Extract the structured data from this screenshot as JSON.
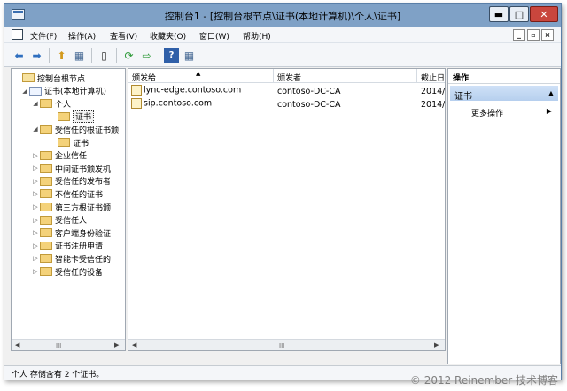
{
  "window": {
    "title": "控制台1 - [控制台根节点\\证书(本地计算机)\\个人\\证书]",
    "controls": {
      "minimize": "▬",
      "maximize": "□",
      "close": "✕"
    }
  },
  "menubar": {
    "items": [
      "文件(F)",
      "操作(A)",
      "查看(V)",
      "收藏夹(O)",
      "窗口(W)",
      "帮助(H)"
    ],
    "mdi_controls": [
      "_",
      "▫",
      "×"
    ]
  },
  "toolbar": {
    "icons": [
      "back-arrow-icon",
      "forward-arrow-icon",
      "up-folder-icon",
      "show-hide-tree-icon",
      "copy-icon",
      "refresh-icon",
      "export-list-icon",
      "help-icon",
      "show-hide-action-pane-icon"
    ],
    "glyphs": [
      "⬅",
      "➡",
      "⬆",
      "▦",
      "▯",
      "⟳",
      "⇨",
      "?",
      "▦"
    ]
  },
  "tree": {
    "items": [
      {
        "label": "控制台根节点",
        "level": 0,
        "expander": "",
        "icon": "root"
      },
      {
        "label": "证书(本地计算机)",
        "level": 1,
        "expander": "◢",
        "icon": "cert"
      },
      {
        "label": "个人",
        "level": 2,
        "expander": "◢",
        "icon": "folder"
      },
      {
        "label": "证书",
        "level": 3,
        "expander": "",
        "icon": "folder",
        "selected": true
      },
      {
        "label": "受信任的根证书颁",
        "level": 2,
        "expander": "◢",
        "icon": "folder"
      },
      {
        "label": "证书",
        "level": 3,
        "expander": "",
        "icon": "folder"
      },
      {
        "label": "企业信任",
        "level": 2,
        "expander": "▷",
        "icon": "folder"
      },
      {
        "label": "中间证书颁发机",
        "level": 2,
        "expander": "▷",
        "icon": "folder"
      },
      {
        "label": "受信任的发布者",
        "level": 2,
        "expander": "▷",
        "icon": "folder"
      },
      {
        "label": "不信任的证书",
        "level": 2,
        "expander": "▷",
        "icon": "folder"
      },
      {
        "label": "第三方根证书颁",
        "level": 2,
        "expander": "▷",
        "icon": "folder"
      },
      {
        "label": "受信任人",
        "level": 2,
        "expander": "▷",
        "icon": "folder"
      },
      {
        "label": "客户端身份验证",
        "level": 2,
        "expander": "▷",
        "icon": "folder"
      },
      {
        "label": "证书注册申请",
        "level": 2,
        "expander": "▷",
        "icon": "folder"
      },
      {
        "label": "智能卡受信任的",
        "level": 2,
        "expander": "▷",
        "icon": "folder"
      },
      {
        "label": "受信任的设备",
        "level": 2,
        "expander": "▷",
        "icon": "folder"
      }
    ],
    "scroll": {
      "left": "◀",
      "grip": "III",
      "right": "▶"
    }
  },
  "list": {
    "columns": [
      "颁发给",
      "颁发者",
      "截止日"
    ],
    "sort_indicator": "▲",
    "rows": [
      {
        "issued_to": "lync-edge.contoso.com",
        "issued_by": "contoso-DC-CA",
        "expires": "2014/"
      },
      {
        "issued_to": "sip.contoso.com",
        "issued_by": "contoso-DC-CA",
        "expires": "2014/"
      }
    ],
    "scroll": {
      "left": "◀",
      "grip": "III",
      "right": "▶"
    }
  },
  "actions": {
    "header": "操作",
    "section": "证书",
    "section_glyph": "▲",
    "items": [
      {
        "label": "更多操作",
        "arrow": "▶"
      }
    ]
  },
  "status": {
    "text": "个人 存储含有 2 个证书。"
  },
  "watermark": "© 2012 Reinember 技术博客"
}
